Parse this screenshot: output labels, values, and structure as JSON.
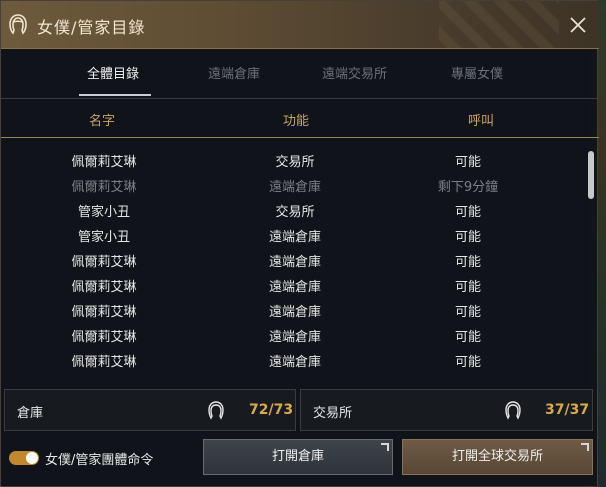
{
  "window": {
    "title": "女僕/管家目錄",
    "close_icon": "close-icon"
  },
  "tabs": [
    {
      "label": "全體目錄",
      "active": true
    },
    {
      "label": "遠端倉庫",
      "active": false
    },
    {
      "label": "遠端交易所",
      "active": false
    },
    {
      "label": "專屬女僕",
      "active": false
    }
  ],
  "columns": {
    "name": "名字",
    "function": "功能",
    "call": "呼叫"
  },
  "rows": [
    {
      "name": "佩爾莉艾琳",
      "function": "交易所",
      "call": "可能",
      "dim": false
    },
    {
      "name": "佩爾莉艾琳",
      "function": "遠端倉庫",
      "call": "剩下9分鐘",
      "dim": true
    },
    {
      "name": "管家小丑",
      "function": "交易所",
      "call": "可能",
      "dim": false
    },
    {
      "name": "管家小丑",
      "function": "遠端倉庫",
      "call": "可能",
      "dim": false
    },
    {
      "name": "佩爾莉艾琳",
      "function": "遠端倉庫",
      "call": "可能",
      "dim": false
    },
    {
      "name": "佩爾莉艾琳",
      "function": "遠端倉庫",
      "call": "可能",
      "dim": false
    },
    {
      "name": "佩爾莉艾琳",
      "function": "遠端倉庫",
      "call": "可能",
      "dim": false
    },
    {
      "name": "佩爾莉艾琳",
      "function": "遠端倉庫",
      "call": "可能",
      "dim": false
    },
    {
      "name": "佩爾莉艾琳",
      "function": "遠端倉庫",
      "call": "可能",
      "dim": false
    }
  ],
  "summary": {
    "storage": {
      "label": "倉庫",
      "count": "72/73",
      "icon": "maid-icon"
    },
    "exchange": {
      "label": "交易所",
      "count": "37/37",
      "icon": "maid-icon"
    }
  },
  "footer": {
    "toggle_label": "女僕/管家團體命令",
    "toggle_on": true,
    "open_storage": "打開倉庫",
    "open_exchange": "打開全球交易所"
  },
  "colors": {
    "accent": "#c8a46a",
    "count": "#d8a94e",
    "toggle": "#c0892f"
  }
}
